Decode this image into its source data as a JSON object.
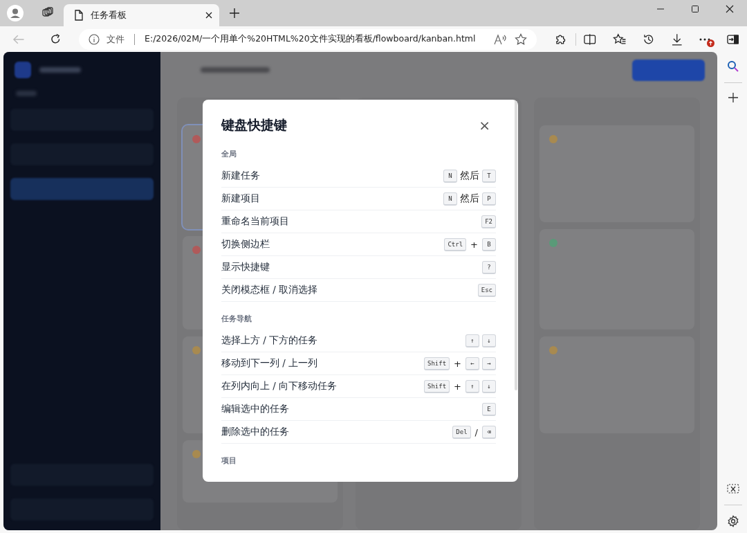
{
  "browser": {
    "tabs": [
      {
        "title": "任务看板",
        "selected": true
      }
    ],
    "address": {
      "scheme_label": "文件",
      "url": "E:/2026/02M/一个用单个%20HTML%20文件实现的看板/flowboard/kanban.html"
    },
    "notification_badge": true
  },
  "app_sidebar": {
    "items": [
      {
        "selected": false
      },
      {
        "selected": false
      },
      {
        "selected": true
      }
    ]
  },
  "modal": {
    "title": "键盘快捷键",
    "close": "×",
    "sections": [
      {
        "title": "全局",
        "shortcuts": [
          {
            "label": "新建任务",
            "keys": [
              {
                "kind": "key",
                "text": "N"
              },
              {
                "kind": "word",
                "text": "然后"
              },
              {
                "kind": "key",
                "text": "T"
              }
            ]
          },
          {
            "label": "新建项目",
            "keys": [
              {
                "kind": "key",
                "text": "N"
              },
              {
                "kind": "word",
                "text": "然后"
              },
              {
                "kind": "key",
                "text": "P"
              }
            ]
          },
          {
            "label": "重命名当前项目",
            "keys": [
              {
                "kind": "key",
                "text": "F2"
              }
            ]
          },
          {
            "label": "切换侧边栏",
            "keys": [
              {
                "kind": "key",
                "text": "Ctrl"
              },
              {
                "kind": "sep",
                "text": "+"
              },
              {
                "kind": "key",
                "text": "B"
              }
            ]
          },
          {
            "label": "显示快捷键",
            "keys": [
              {
                "kind": "key",
                "text": "?"
              }
            ]
          },
          {
            "label": "关闭模态框 / 取消选择",
            "keys": [
              {
                "kind": "key",
                "text": "Esc"
              }
            ]
          }
        ]
      },
      {
        "title": "任务导航",
        "shortcuts": [
          {
            "label": "选择上方 / 下方的任务",
            "keys": [
              {
                "kind": "key",
                "text": "↑"
              },
              {
                "kind": "key",
                "text": "↓"
              }
            ]
          },
          {
            "label": "移动到下一列 / 上一列",
            "keys": [
              {
                "kind": "key",
                "text": "Shift"
              },
              {
                "kind": "sep",
                "text": "+"
              },
              {
                "kind": "key",
                "text": "←"
              },
              {
                "kind": "key",
                "text": "→"
              }
            ]
          },
          {
            "label": "在列内向上 / 向下移动任务",
            "keys": [
              {
                "kind": "key",
                "text": "Shift"
              },
              {
                "kind": "sep",
                "text": "+"
              },
              {
                "kind": "key",
                "text": "↑"
              },
              {
                "kind": "key",
                "text": "↓"
              }
            ]
          },
          {
            "label": "编辑选中的任务",
            "keys": [
              {
                "kind": "key",
                "text": "E"
              }
            ]
          },
          {
            "label": "删除选中的任务",
            "keys": [
              {
                "kind": "key",
                "text": "Del"
              },
              {
                "kind": "sep",
                "text": "/"
              },
              {
                "kind": "key",
                "text": "⌫"
              }
            ]
          }
        ]
      },
      {
        "title": "项目"
      }
    ]
  }
}
